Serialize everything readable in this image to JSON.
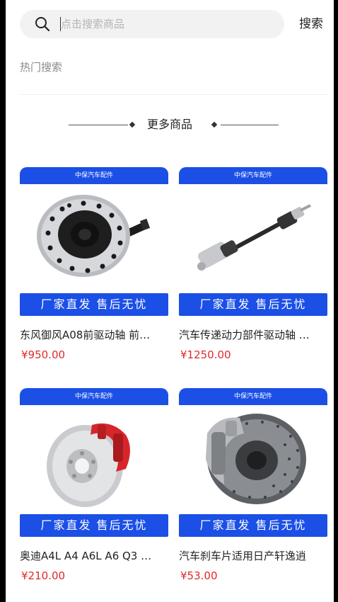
{
  "search": {
    "placeholder": "点击搜索商品",
    "button_label": "搜索"
  },
  "hot_search": {
    "title": "热门搜索"
  },
  "more_goods": {
    "title": "更多商品"
  },
  "products": [
    {
      "brand": "中保汽车配件",
      "slogan": "厂家直发 售后无忧",
      "name": "东风御风A08前驱动轴 前…",
      "price": "¥950.00",
      "image": "drive-flange-icon"
    },
    {
      "brand": "中保汽车配件",
      "slogan": "厂家直发 售后无忧",
      "name": "汽车传递动力部件驱动轴 …",
      "price": "¥1250.00",
      "image": "drive-shaft-icon"
    },
    {
      "brand": "中保汽车配件",
      "slogan": "厂家直发 售后无忧",
      "name": "奥迪A4L A4 A6L A6 Q3 …",
      "price": "¥210.00",
      "image": "brake-disc-red-caliper-icon"
    },
    {
      "brand": "中保汽车配件",
      "slogan": "厂家直发 售后无忧",
      "name": "汽车刹车片适用日产轩逸逍",
      "price": "¥53.00",
      "image": "brake-disc-drilled-icon"
    }
  ],
  "colors": {
    "accent": "#1b4fe6",
    "price": "#e0292b",
    "search_bg": "#f2f2f2"
  }
}
